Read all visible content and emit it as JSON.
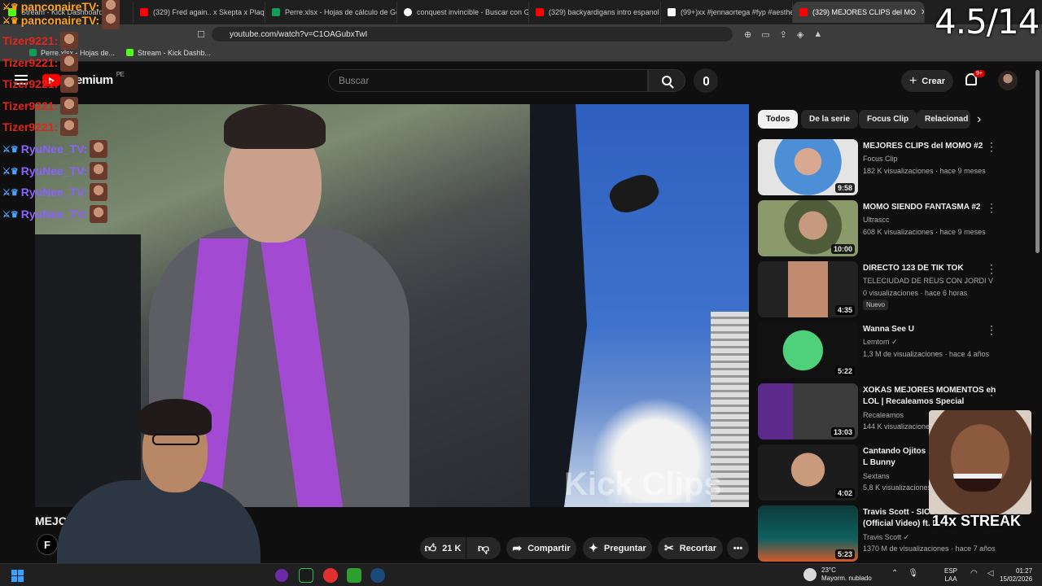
{
  "browser": {
    "tabs": [
      {
        "label": "Stream - Kick Dashboard",
        "color": "#53fc18"
      },
      {
        "label": "(329) Fred again.. x Skepta x Plaquebo",
        "color": "#ff0000"
      },
      {
        "label": "Perre.xlsx - Hojas de cálculo de Goog",
        "color": "#0f9d58"
      },
      {
        "label": "conquest invincible - Buscar con Goo",
        "color": "#ffffff"
      },
      {
        "label": "(329) backyardigans intro espanol lat",
        "color": "#ff0000"
      },
      {
        "label": "(99+)xx #jennaortega #fyp #aesthet",
        "color": "#ffffff"
      },
      {
        "label": "(329) MEJORES CLIPS del MO",
        "color": "#ff0000"
      }
    ],
    "url": "youtube.com/watch?v=C1OAGubxTwI",
    "bookmarks": [
      {
        "label": "Perre.xlsx - Hojas de...",
        "color": "#0f9d58"
      },
      {
        "label": "Stream - Kick Dashb...",
        "color": "#53fc18"
      }
    ]
  },
  "youtube": {
    "logo_text": "Premium",
    "region": "PE",
    "search_placeholder": "Buscar",
    "create_label": "Crear",
    "notif_count": "9+"
  },
  "video": {
    "watermark": "Kick Clips",
    "title": "MEJOR",
    "channel_logo": "F",
    "actions": {
      "likes": "21 K",
      "share": "Compartir",
      "ask": "Preguntar",
      "clip": "Recortar",
      "more": "•••"
    }
  },
  "chips": [
    "Todos",
    "De la serie",
    "Focus Clip",
    "Relacionad"
  ],
  "recommendations": [
    {
      "title": "MEJORES CLIPS del MOMO #2",
      "channel": "Focus Clip",
      "meta": "182 K visualizaciones · hace 9 meses",
      "duration": "9:58",
      "badge": ""
    },
    {
      "title": "MOMO SIENDO FANTASMA #2",
      "channel": "Ultrascc",
      "meta": "608 K visualizaciones · hace 9 meses",
      "duration": "10:00",
      "badge": ""
    },
    {
      "title": "DIRECTO 123 DE TIK TOK",
      "channel": "TELECIUDAD DE REUS CON JORDI VILL...",
      "meta": "0 visualizaciones · hace 6 horas",
      "duration": "4:35",
      "badge": "Nuevo"
    },
    {
      "title": "Wanna See U",
      "channel": "Lemtom ✓",
      "meta": "1,3 M de visualizaciones · hace 4 años",
      "duration": "5:22",
      "badge": ""
    },
    {
      "title": "XOKAS MEJORES MOMENTOS en LOL | Recaleamos Special",
      "channel": "Recaleamos",
      "meta": "144 K visualizaciones",
      "duration": "13:03",
      "badge": ""
    },
    {
      "title": "Cantando Ojitos L Bunny",
      "channel": "Sextans",
      "meta": "5,8 K visualizaciones",
      "duration": "4:02",
      "badge": ""
    },
    {
      "title": "Travis Scott - SICKO MODE (Official Video) ft. D",
      "channel": "Travis Scott ✓",
      "meta": "1370 M de visualizaciones · hace 7 años",
      "duration": "5:23",
      "badge": ""
    }
  ],
  "overlay": {
    "counter": "4.5/14",
    "streak": "14x STREAK",
    "chat": [
      {
        "user": "panconaireTV:",
        "style": "orange"
      },
      {
        "user": "panconaireTV:",
        "style": "orange"
      },
      {
        "user": "Tizer9221:",
        "style": "red"
      },
      {
        "user": "Tizer9221:",
        "style": "red"
      },
      {
        "user": "Tizer9221:",
        "style": "red"
      },
      {
        "user": "Tizer9221:",
        "style": "red"
      },
      {
        "user": "Tizer9221:",
        "style": "red"
      },
      {
        "user": "RyuNee_TV:",
        "style": "purple"
      },
      {
        "user": "RyuNee_TV:",
        "style": "purple"
      },
      {
        "user": "RyuNee_TV:",
        "style": "purple"
      },
      {
        "user": "RyuNee_TV:",
        "style": "purple"
      }
    ]
  },
  "taskbar": {
    "weather_temp": "23°C",
    "weather_desc": "Mayorm. nublado",
    "lang1": "ESP",
    "lang2": "LAA",
    "time": "01:27",
    "date": "15/02/2026"
  }
}
